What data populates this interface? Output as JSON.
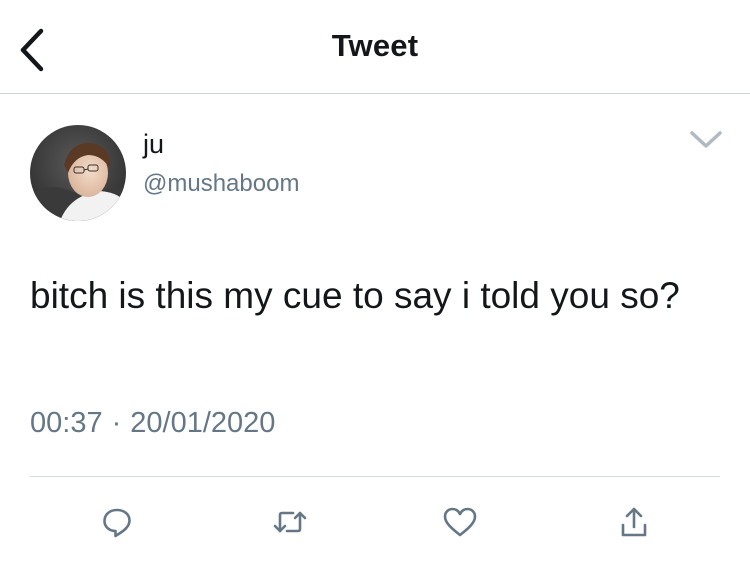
{
  "header": {
    "title": "Tweet",
    "back_icon": "chevron-left-icon"
  },
  "author": {
    "display_name": "ju",
    "handle": "@mushaboom",
    "avatar": "profile-photo"
  },
  "tweet": {
    "text": "bitch is this my cue to say i told you so?",
    "time": "00:37",
    "separator": "·",
    "date": "20/01/2020"
  },
  "actions": [
    {
      "icon": "reply-icon"
    },
    {
      "icon": "retweet-icon"
    },
    {
      "icon": "like-icon"
    },
    {
      "icon": "share-icon"
    }
  ],
  "colors": {
    "text": "#14171a",
    "secondary": "#657786",
    "icon": "#657786",
    "divider": "#d5d9dc"
  }
}
